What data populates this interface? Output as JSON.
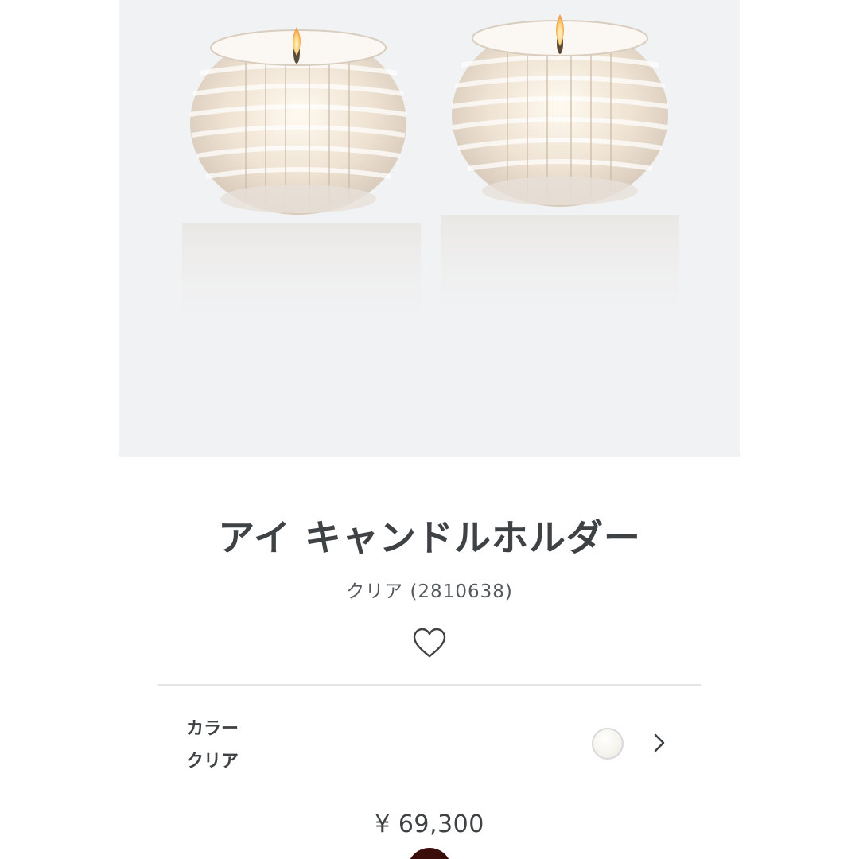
{
  "product": {
    "name": "アイ キャンドルホルダー",
    "variant_text": "クリア (2810638)",
    "price": "¥ 69,300"
  },
  "color_selector": {
    "label": "カラー",
    "value": "クリア",
    "swatch_color": "#f3f1ec"
  },
  "icons": {
    "favorite": "heart-outline-icon",
    "chevron": "chevron-right-icon"
  },
  "colors": {
    "image_background": "#f1f2f4",
    "text_primary": "#3e4245",
    "divider": "#e3e4e6",
    "bottom_button": "#3a0e0b"
  }
}
